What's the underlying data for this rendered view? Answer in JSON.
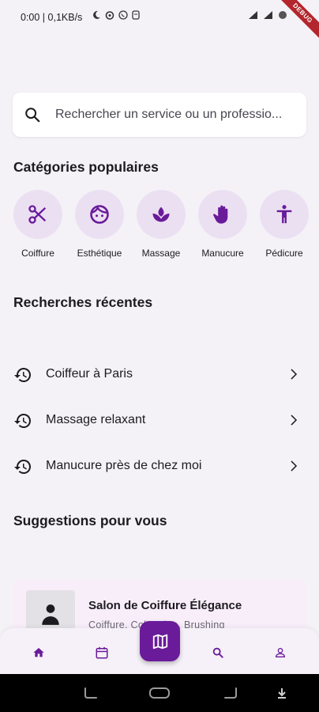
{
  "status_bar": {
    "text": "0:00 | 0,1KB/s",
    "debug_label": "DEBUG"
  },
  "search": {
    "placeholder": "Rechercher un service ou un professio..."
  },
  "categories_section": {
    "title": "Catégories populaires",
    "items": [
      {
        "label": "Coiffure",
        "icon": "scissors-icon"
      },
      {
        "label": "Esthétique",
        "icon": "face-icon"
      },
      {
        "label": "Massage",
        "icon": "spa-icon"
      },
      {
        "label": "Manucure",
        "icon": "hand-icon"
      },
      {
        "label": "Pédicure",
        "icon": "accessibility-icon"
      }
    ]
  },
  "recent_section": {
    "title": "Recherches récentes",
    "items": [
      {
        "label": "Coiffeur à Paris"
      },
      {
        "label": "Massage relaxant"
      },
      {
        "label": "Manucure près de chez moi"
      }
    ]
  },
  "suggestions_section": {
    "title": "Suggestions pour vous",
    "card": {
      "title": "Salon de Coiffure Élégance",
      "subtitle": "Coiffure, Coloration, Brushing"
    }
  },
  "bottom_nav": {
    "items": [
      "home-icon",
      "calendar-icon",
      "map-icon",
      "search-icon",
      "person-icon"
    ],
    "active_color": "#6a1b9a"
  },
  "colors": {
    "accent": "#6a1b9a",
    "category_bg": "#ebe0f2",
    "background": "#f4f2f7"
  }
}
